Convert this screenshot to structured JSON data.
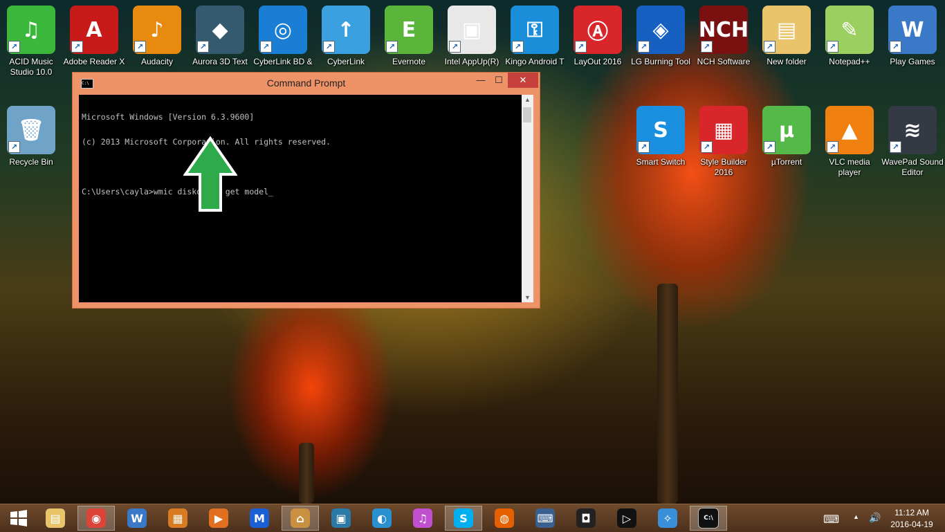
{
  "desktop": {
    "icons_row1": [
      {
        "label": "ACID Music Studio 10.0",
        "glyph": "♫",
        "color": "#3bb83b"
      },
      {
        "label": "Adobe Reader X",
        "glyph": "A",
        "color": "#c91a1a"
      },
      {
        "label": "Audacity",
        "glyph": "♪",
        "color": "#e88a10"
      },
      {
        "label": "Aurora 3D Text",
        "glyph": "◆",
        "color": "#355a70"
      },
      {
        "label": "CyberLink BD &",
        "glyph": "◎",
        "color": "#1a7fd4"
      },
      {
        "label": "CyberLink",
        "glyph": "↑",
        "color": "#3aa0e0"
      },
      {
        "label": "Evernote",
        "glyph": "E",
        "color": "#5bb53b"
      },
      {
        "label": "Intel AppUp(R)",
        "glyph": "▣",
        "color": "#e8e8e8"
      },
      {
        "label": "Kingo Android T",
        "glyph": "⚿",
        "color": "#1a8ed8"
      },
      {
        "label": "LayOut 2016",
        "glyph": "Ⓐ",
        "color": "#d8262b"
      },
      {
        "label": "LG Burning Tool",
        "glyph": "◈",
        "color": "#1560c0"
      },
      {
        "label": "NCH Software",
        "glyph": "NCH",
        "color": "#7a1010"
      },
      {
        "label": "New folder",
        "glyph": "▤",
        "color": "#e9c46a"
      },
      {
        "label": "Notepad++",
        "glyph": "✎",
        "color": "#9bcf5f"
      },
      {
        "label": "Play Games",
        "glyph": "W",
        "color": "#3a78c8"
      }
    ],
    "icons_row2_left": [
      {
        "label": "Recycle Bin",
        "glyph": "🗑",
        "color": "#6fa3c8"
      }
    ],
    "icons_row2_right": [
      {
        "label": "Smart Switch",
        "glyph": "S",
        "color": "#1a8fe0"
      },
      {
        "label": "Style Builder 2016",
        "glyph": "▦",
        "color": "#d8262b"
      },
      {
        "label": "µTorrent",
        "glyph": "µ",
        "color": "#54b948"
      },
      {
        "label": "VLC media player",
        "glyph": "▲",
        "color": "#f08010"
      },
      {
        "label": "WavePad Sound Editor",
        "glyph": "≋",
        "color": "#333a44"
      }
    ]
  },
  "window": {
    "title": "Command Prompt",
    "icon": "cmd-icon",
    "minimize": "—",
    "maximize": "☐",
    "close": "✕",
    "console_lines": [
      "Microsoft Windows [Version 6.3.9600]",
      "(c) 2013 Microsoft Corporation. All rights reserved.",
      "",
      "C:\\Users\\cayla>wmic diskdrive get model_"
    ],
    "arrow_color": "#2eaa4a"
  },
  "taskbar": {
    "start_icon": "windows-logo-icon",
    "apps": [
      {
        "name": "file-explorer",
        "glyph": "▤",
        "color": "#e9c46a",
        "active": false
      },
      {
        "name": "chrome",
        "glyph": "◉",
        "color": "#db4437",
        "active": true
      },
      {
        "name": "play-games",
        "glyph": "W",
        "color": "#3a78c8",
        "active": false
      },
      {
        "name": "app-tiles",
        "glyph": "▦",
        "color": "#d97b20",
        "active": false
      },
      {
        "name": "media-player",
        "glyph": "▶",
        "color": "#e07020",
        "active": false
      },
      {
        "name": "malwarebytes",
        "glyph": "M",
        "color": "#1a5fd4",
        "active": false
      },
      {
        "name": "store",
        "glyph": "⌂",
        "color": "#c89040",
        "active": true
      },
      {
        "name": "video-editor",
        "glyph": "▣",
        "color": "#2a7aa8",
        "active": false
      },
      {
        "name": "bird-app",
        "glyph": "◐",
        "color": "#2a90d0",
        "active": false
      },
      {
        "name": "itunes",
        "glyph": "♫",
        "color": "#c050d0",
        "active": false
      },
      {
        "name": "skype",
        "glyph": "S",
        "color": "#00aff0",
        "active": true
      },
      {
        "name": "firefox",
        "glyph": "◍",
        "color": "#e66000",
        "active": false
      },
      {
        "name": "remote-desktop",
        "glyph": "⌨",
        "color": "#3a6090",
        "active": false
      },
      {
        "name": "webcam-app",
        "glyph": "◘",
        "color": "#222222",
        "active": false
      },
      {
        "name": "player-app",
        "glyph": "▷",
        "color": "#111111",
        "active": false
      },
      {
        "name": "safari",
        "glyph": "✧",
        "color": "#3a90d8",
        "active": false
      },
      {
        "name": "command-prompt",
        "glyph": "C:\\",
        "color": "#111111",
        "active": true
      }
    ],
    "time": "11:12 AM",
    "date": "2016-04-19"
  }
}
